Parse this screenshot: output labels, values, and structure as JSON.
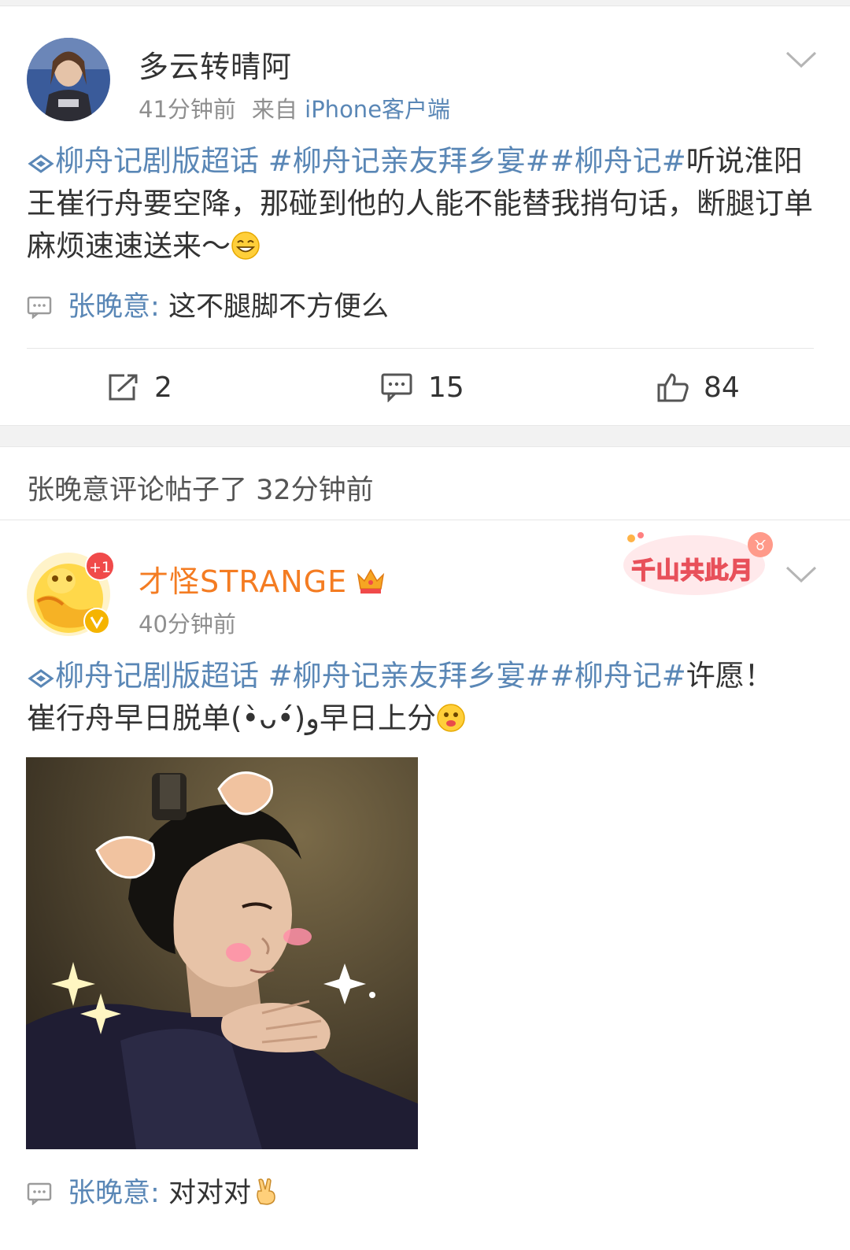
{
  "post1": {
    "username": "多云转晴阿",
    "time": "41分钟前",
    "source_prefix": "来自",
    "source": "iPhone客户端",
    "topic1": "柳舟记剧版超话",
    "topic2": "#柳舟记亲友拜乡宴#",
    "topic3": "#柳舟记#",
    "body_text": "听说淮阳王崔行舟要空降，那碰到他的人能不能替我捎句话，断腿订单麻烦速速送来～",
    "comment": {
      "name": "张晚意",
      "colon": ":",
      "text": "这不腿脚不方便么"
    },
    "actions": {
      "repost": "2",
      "comments": "15",
      "likes": "84"
    }
  },
  "notice": "张晚意评论帖子了 32分钟前",
  "post2": {
    "username": "才怪STRANGE",
    "badge": "+1",
    "time": "40分钟前",
    "sticker_text": "千山共此月",
    "topic1": "柳舟记剧版超话",
    "topic2": "#柳舟记亲友拜乡宴#",
    "topic3": "#柳舟记#",
    "body_text1": "许愿！",
    "body_text2": "崔行舟早日脱单(•̀ᴗ•́)و早日上分",
    "comment": {
      "name": "张晚意",
      "colon": ":",
      "text": "对对对"
    }
  },
  "colors": {
    "link": "#5a87b6",
    "username_orange": "#f47c22",
    "text": "#333333",
    "meta": "#8f8f8f"
  }
}
